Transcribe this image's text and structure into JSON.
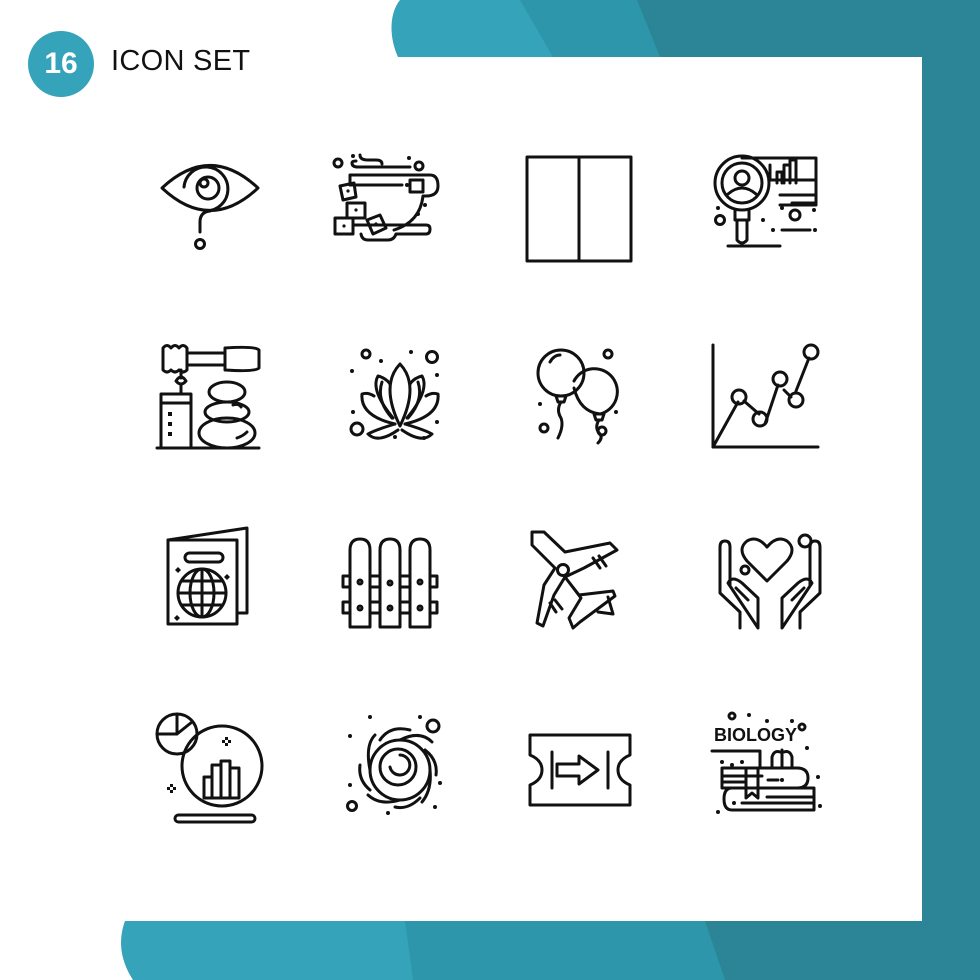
{
  "header": {
    "badge_number": "16",
    "title": "ICON SET"
  },
  "colors": {
    "teal_light": "#35a3b9",
    "teal_mid": "#2e96aa",
    "teal_dark": "#2b8596",
    "card": "#ffffff",
    "stroke": "#111111"
  },
  "icons": [
    {
      "name": "eye-drop-icon",
      "label": "eye"
    },
    {
      "name": "tea-cup-sugar-icon",
      "label": "tea cup with sugar cubes"
    },
    {
      "name": "two-column-layout-icon",
      "label": "layout columns"
    },
    {
      "name": "user-search-analytics-icon",
      "label": "user search analytics"
    },
    {
      "name": "spa-honey-candle-stones-icon",
      "label": "spa"
    },
    {
      "name": "lotus-icon",
      "label": "lotus"
    },
    {
      "name": "balloons-icon",
      "label": "balloons"
    },
    {
      "name": "line-chart-icon",
      "label": "line chart"
    },
    {
      "name": "passport-icon",
      "label": "passport"
    },
    {
      "name": "fence-icon",
      "label": "fence"
    },
    {
      "name": "airplane-icon",
      "label": "airplane"
    },
    {
      "name": "hands-heart-icon",
      "label": "hands holding heart"
    },
    {
      "name": "business-report-icon",
      "label": "pie and bar report"
    },
    {
      "name": "black-hole-icon",
      "label": "black hole galaxy"
    },
    {
      "name": "ticket-arrow-icon",
      "label": "ticket"
    },
    {
      "name": "biology-books-icon",
      "label": "biology",
      "text": "BIOLOGY"
    }
  ]
}
